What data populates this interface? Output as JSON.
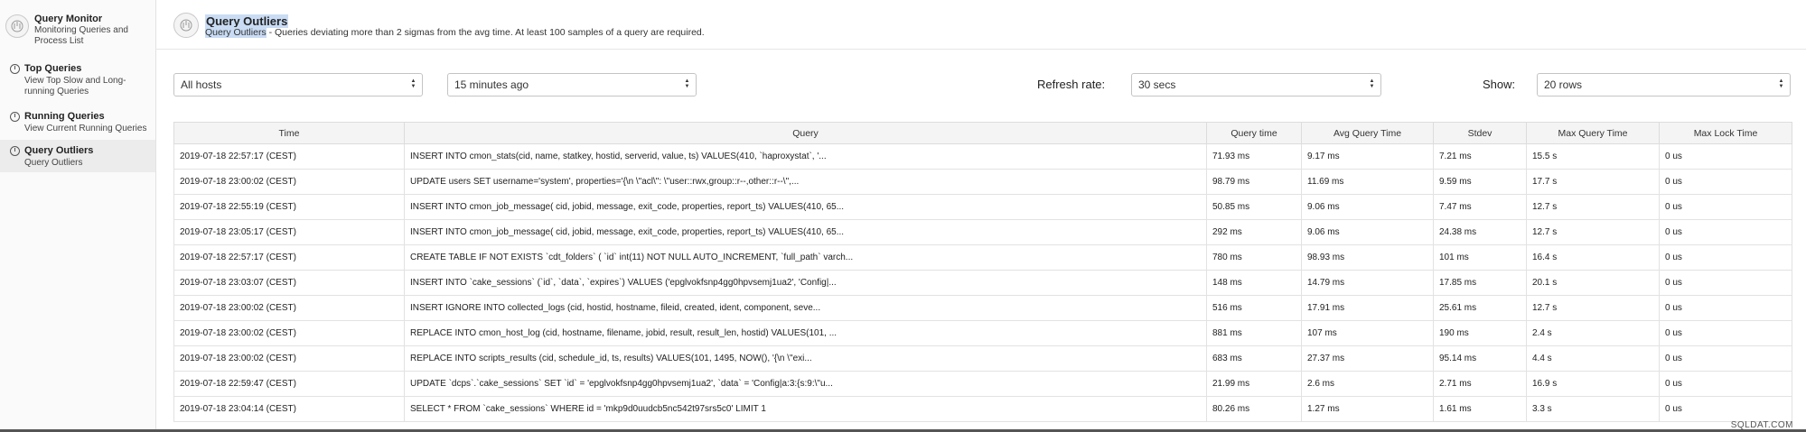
{
  "sidebar": {
    "app_title": "Query Monitor",
    "app_subtitle": "Monitoring Queries and Process List",
    "items": [
      {
        "label": "Top Queries",
        "desc": "View Top Slow and Long-running Queries"
      },
      {
        "label": "Running Queries",
        "desc": "View Current Running Queries"
      },
      {
        "label": "Query Outliers",
        "desc": "Query Outliers"
      }
    ],
    "active_index": 2
  },
  "header": {
    "title": "Query Outliers",
    "subtitle_highlight": "Query Outliers",
    "subtitle_rest": " - Queries deviating more than 2 sigmas from the avg time. At least 100 samples of a query are required."
  },
  "controls": {
    "hosts_value": "All hosts",
    "time_value": "15 minutes ago",
    "refresh_label": "Refresh rate:",
    "refresh_value": "30 secs",
    "show_label": "Show:",
    "show_value": "20 rows"
  },
  "table": {
    "columns": [
      "Time",
      "Query",
      "Query time",
      "Avg Query Time",
      "Stdev",
      "Max Query Time",
      "Max Lock Time"
    ],
    "rows": [
      [
        "2019-07-18 22:57:17 (CEST)",
        "INSERT INTO cmon_stats(cid, name, statkey, hostid, serverid, value, ts) VALUES(410, `haproxystat`, '...",
        "71.93 ms",
        "9.17 ms",
        "7.21 ms",
        "15.5 s",
        "0 us"
      ],
      [
        "2019-07-18 23:00:02 (CEST)",
        "UPDATE users SET username='system', properties='{\\n \\\"acl\\\": \\\"user::rwx,group::r--,other::r--\\\",...",
        "98.79 ms",
        "11.69 ms",
        "9.59 ms",
        "17.7 s",
        "0 us"
      ],
      [
        "2019-07-18 22:55:19 (CEST)",
        "INSERT INTO cmon_job_message( cid, jobid, message, exit_code, properties, report_ts) VALUES(410, 65...",
        "50.85 ms",
        "9.06 ms",
        "7.47 ms",
        "12.7 s",
        "0 us"
      ],
      [
        "2019-07-18 23:05:17 (CEST)",
        "INSERT INTO cmon_job_message( cid, jobid, message, exit_code, properties, report_ts) VALUES(410, 65...",
        "292 ms",
        "9.06 ms",
        "24.38 ms",
        "12.7 s",
        "0 us"
      ],
      [
        "2019-07-18 22:57:17 (CEST)",
        "CREATE TABLE IF NOT EXISTS `cdt_folders` ( `id` int(11) NOT NULL AUTO_INCREMENT, `full_path` varch...",
        "780 ms",
        "98.93 ms",
        "101 ms",
        "16.4 s",
        "0 us"
      ],
      [
        "2019-07-18 23:03:07 (CEST)",
        "INSERT INTO `cake_sessions` (`id`, `data`, `expires`) VALUES ('epglvokfsnp4gg0hpvsemj1ua2', 'Config|...",
        "148 ms",
        "14.79 ms",
        "17.85 ms",
        "20.1 s",
        "0 us"
      ],
      [
        "2019-07-18 23:00:02 (CEST)",
        "INSERT IGNORE INTO collected_logs (cid, hostid, hostname, fileid, created, ident, component, seve...",
        "516 ms",
        "17.91 ms",
        "25.61 ms",
        "12.7 s",
        "0 us"
      ],
      [
        "2019-07-18 23:00:02 (CEST)",
        "REPLACE INTO cmon_host_log (cid, hostname, filename, jobid, result, result_len, hostid) VALUES(101, ...",
        "881 ms",
        "107 ms",
        "190 ms",
        "2.4 s",
        "0 us"
      ],
      [
        "2019-07-18 23:00:02 (CEST)",
        "REPLACE INTO scripts_results (cid, schedule_id, ts, results) VALUES(101, 1495, NOW(), '{\\n \\\"exi...",
        "683 ms",
        "27.37 ms",
        "95.14 ms",
        "4.4 s",
        "0 us"
      ],
      [
        "2019-07-18 22:59:47 (CEST)",
        "UPDATE `dcps`.`cake_sessions` SET `id` = 'epglvokfsnp4gg0hpvsemj1ua2', `data` = 'Config|a:3:{s:9:\\\"u...",
        "21.99 ms",
        "2.6 ms",
        "2.71 ms",
        "16.9 s",
        "0 us"
      ],
      [
        "2019-07-18 23:04:14 (CEST)",
        "SELECT * FROM `cake_sessions` WHERE id = 'mkp9d0uudcb5nc542t97srs5c0' LIMIT 1",
        "80.26 ms",
        "1.27 ms",
        "1.61 ms",
        "3.3 s",
        "0 us"
      ]
    ]
  },
  "watermark": "SQLDAT.COM",
  "icons": {
    "app": "query-monitor-icon",
    "nav": "clock-icon",
    "select": "updown-arrows-icon"
  }
}
